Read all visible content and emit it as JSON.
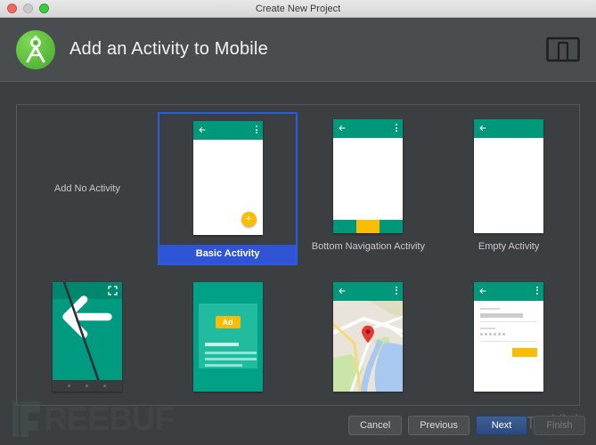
{
  "window": {
    "title": "Create New Project",
    "traffic_lights": [
      "close",
      "minimize",
      "zoom"
    ]
  },
  "header": {
    "title": "Add an Activity to Mobile",
    "app_icon": "android-studio-icon",
    "device_icon": "device-preview-icon"
  },
  "activities": {
    "no_activity_label": "Add No Activity",
    "row1": [
      {
        "label": "Basic Activity",
        "selected": true,
        "thumb": "basic"
      },
      {
        "label": "Bottom Navigation Activity",
        "selected": false,
        "thumb": "bottom-nav"
      },
      {
        "label": "Empty Activity",
        "selected": false,
        "thumb": "empty"
      }
    ],
    "row2": [
      {
        "label": "",
        "selected": false,
        "thumb": "fullscreen"
      },
      {
        "label": "",
        "selected": false,
        "thumb": "ad"
      },
      {
        "label": "",
        "selected": false,
        "thumb": "maps"
      },
      {
        "label": "",
        "selected": false,
        "thumb": "login"
      }
    ]
  },
  "footer": {
    "cancel": "Cancel",
    "previous": "Previous",
    "next": "Next",
    "finish": "Finish"
  },
  "watermark": {
    "text": "REEBUF",
    "overlay": "@51CTO博客"
  },
  "colors": {
    "accent_blue": "#2f54d6",
    "material_teal": "#00987a",
    "amber": "#fbbc04",
    "window_bg": "#3c3f41",
    "header_bg": "#4a4d4f"
  }
}
